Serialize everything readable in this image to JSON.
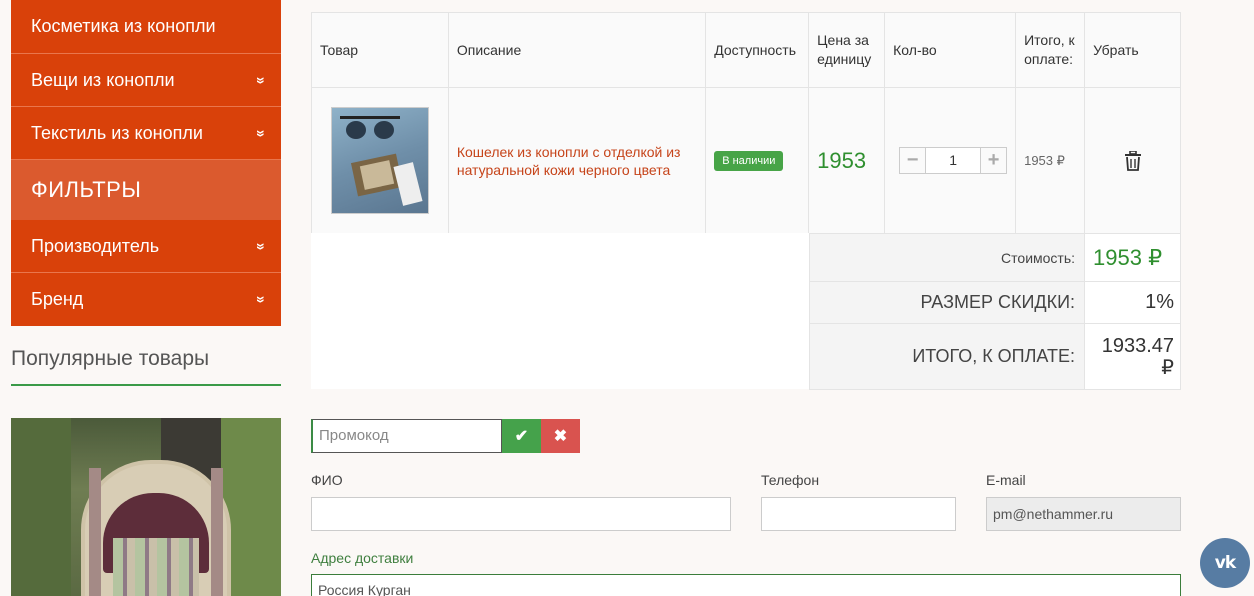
{
  "sidebar": {
    "menu": [
      {
        "label": "Косметика из конопли",
        "chevron": ""
      },
      {
        "label": "Вещи из конопли",
        "chevron": "»"
      },
      {
        "label": "Текстиль из конопли",
        "chevron": "»"
      }
    ],
    "filters_header": "ФИЛЬТРЫ",
    "filters": [
      {
        "label": "Производитель",
        "chevron": "»"
      },
      {
        "label": "Бренд",
        "chevron": "»"
      }
    ],
    "popular_title": "Популярные товары"
  },
  "cart": {
    "headers": {
      "product": "Товар",
      "description": "Описание",
      "availability": "Доступность",
      "unit_price": "Цена за единицу",
      "quantity": "Кол-во",
      "total": "Итого, к оплате:",
      "remove": "Убрать"
    },
    "item": {
      "name": "Кошелек из конопли с отделкой из натуральной кожи черного цвета",
      "availability": "В наличии",
      "unit_price": "1953",
      "quantity": "1",
      "minus": "−",
      "plus": "+",
      "total": "1953 ₽"
    }
  },
  "summary": {
    "cost_label": "Стоимость:",
    "cost_value": "1953 ₽",
    "discount_label": "РАЗМЕР СКИДКИ:",
    "discount_value": "1%",
    "total_label": "ИТОГО, К ОПЛАТЕ:",
    "total_value": "1933.47 ₽"
  },
  "promo": {
    "placeholder": "Промокод",
    "apply_icon": "✔",
    "clear_icon": "✖"
  },
  "form": {
    "name_label": "ФИО",
    "name_value": "",
    "phone_label": "Телефон",
    "phone_value": "",
    "email_label": "E-mail",
    "email_value": "pm@nethammer.ru",
    "address_label": "Адрес доставки",
    "address_value": "Россия Курган"
  },
  "social": {
    "vk_label": "vk"
  },
  "colors": {
    "menu_bg": "#d9410a",
    "accent_green": "#2f8f2f",
    "link": "#c6441a"
  }
}
